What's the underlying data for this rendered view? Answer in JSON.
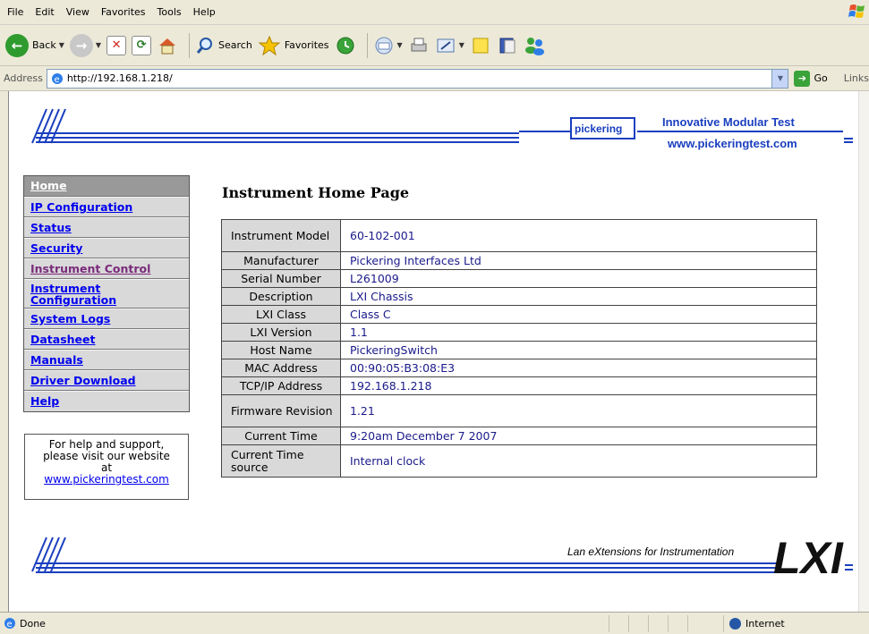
{
  "menubar": {
    "items": [
      "File",
      "Edit",
      "View",
      "Favorites",
      "Tools",
      "Help"
    ]
  },
  "toolbar": {
    "back": "Back",
    "search": "Search",
    "favorites": "Favorites"
  },
  "address": {
    "label": "Address",
    "url": "http://192.168.1.218/",
    "go": "Go",
    "links": "Links"
  },
  "header": {
    "brand": "pickering",
    "tagline": "Innovative Modular Test",
    "site": "www.pickeringtest.com"
  },
  "nav": [
    {
      "label": "Home"
    },
    {
      "label": "IP Configuration"
    },
    {
      "label": "Status"
    },
    {
      "label": "Security"
    },
    {
      "label": "Instrument Control"
    },
    {
      "label": "Instrument Configuration"
    },
    {
      "label": "System Logs"
    },
    {
      "label": "Datasheet"
    },
    {
      "label": "Manuals"
    },
    {
      "label": "Driver Download"
    },
    {
      "label": "Help"
    }
  ],
  "help": {
    "line1": "For help and support,",
    "line2": "please visit our website",
    "line3": "at",
    "link": "www.pickeringtest.com"
  },
  "main": {
    "title": "Instrument Home Page",
    "rows": [
      {
        "key": "Instrument Model",
        "value": "60-102-001"
      },
      {
        "key": "Manufacturer",
        "value": "Pickering Interfaces Ltd"
      },
      {
        "key": "Serial Number",
        "value": "L261009"
      },
      {
        "key": "Description",
        "value": "LXI Chassis"
      },
      {
        "key": "LXI Class",
        "value": "Class C"
      },
      {
        "key": "LXI Version",
        "value": "1.1"
      },
      {
        "key": "Host Name",
        "value": "PickeringSwitch"
      },
      {
        "key": "MAC Address",
        "value": "00:90:05:B3:08:E3"
      },
      {
        "key": "TCP/IP Address",
        "value": "192.168.1.218"
      },
      {
        "key": "Firmware Revision",
        "value": "1.21"
      },
      {
        "key": "Current Time",
        "value": "9:20am December 7 2007"
      },
      {
        "key": "Current Time source",
        "value": "Internal clock"
      }
    ]
  },
  "footer": {
    "lxi_text": "Lan eXtensions for Instrumentation",
    "lxi_logo": "LXI"
  },
  "status": {
    "text": "Done",
    "zone": "Internet"
  }
}
